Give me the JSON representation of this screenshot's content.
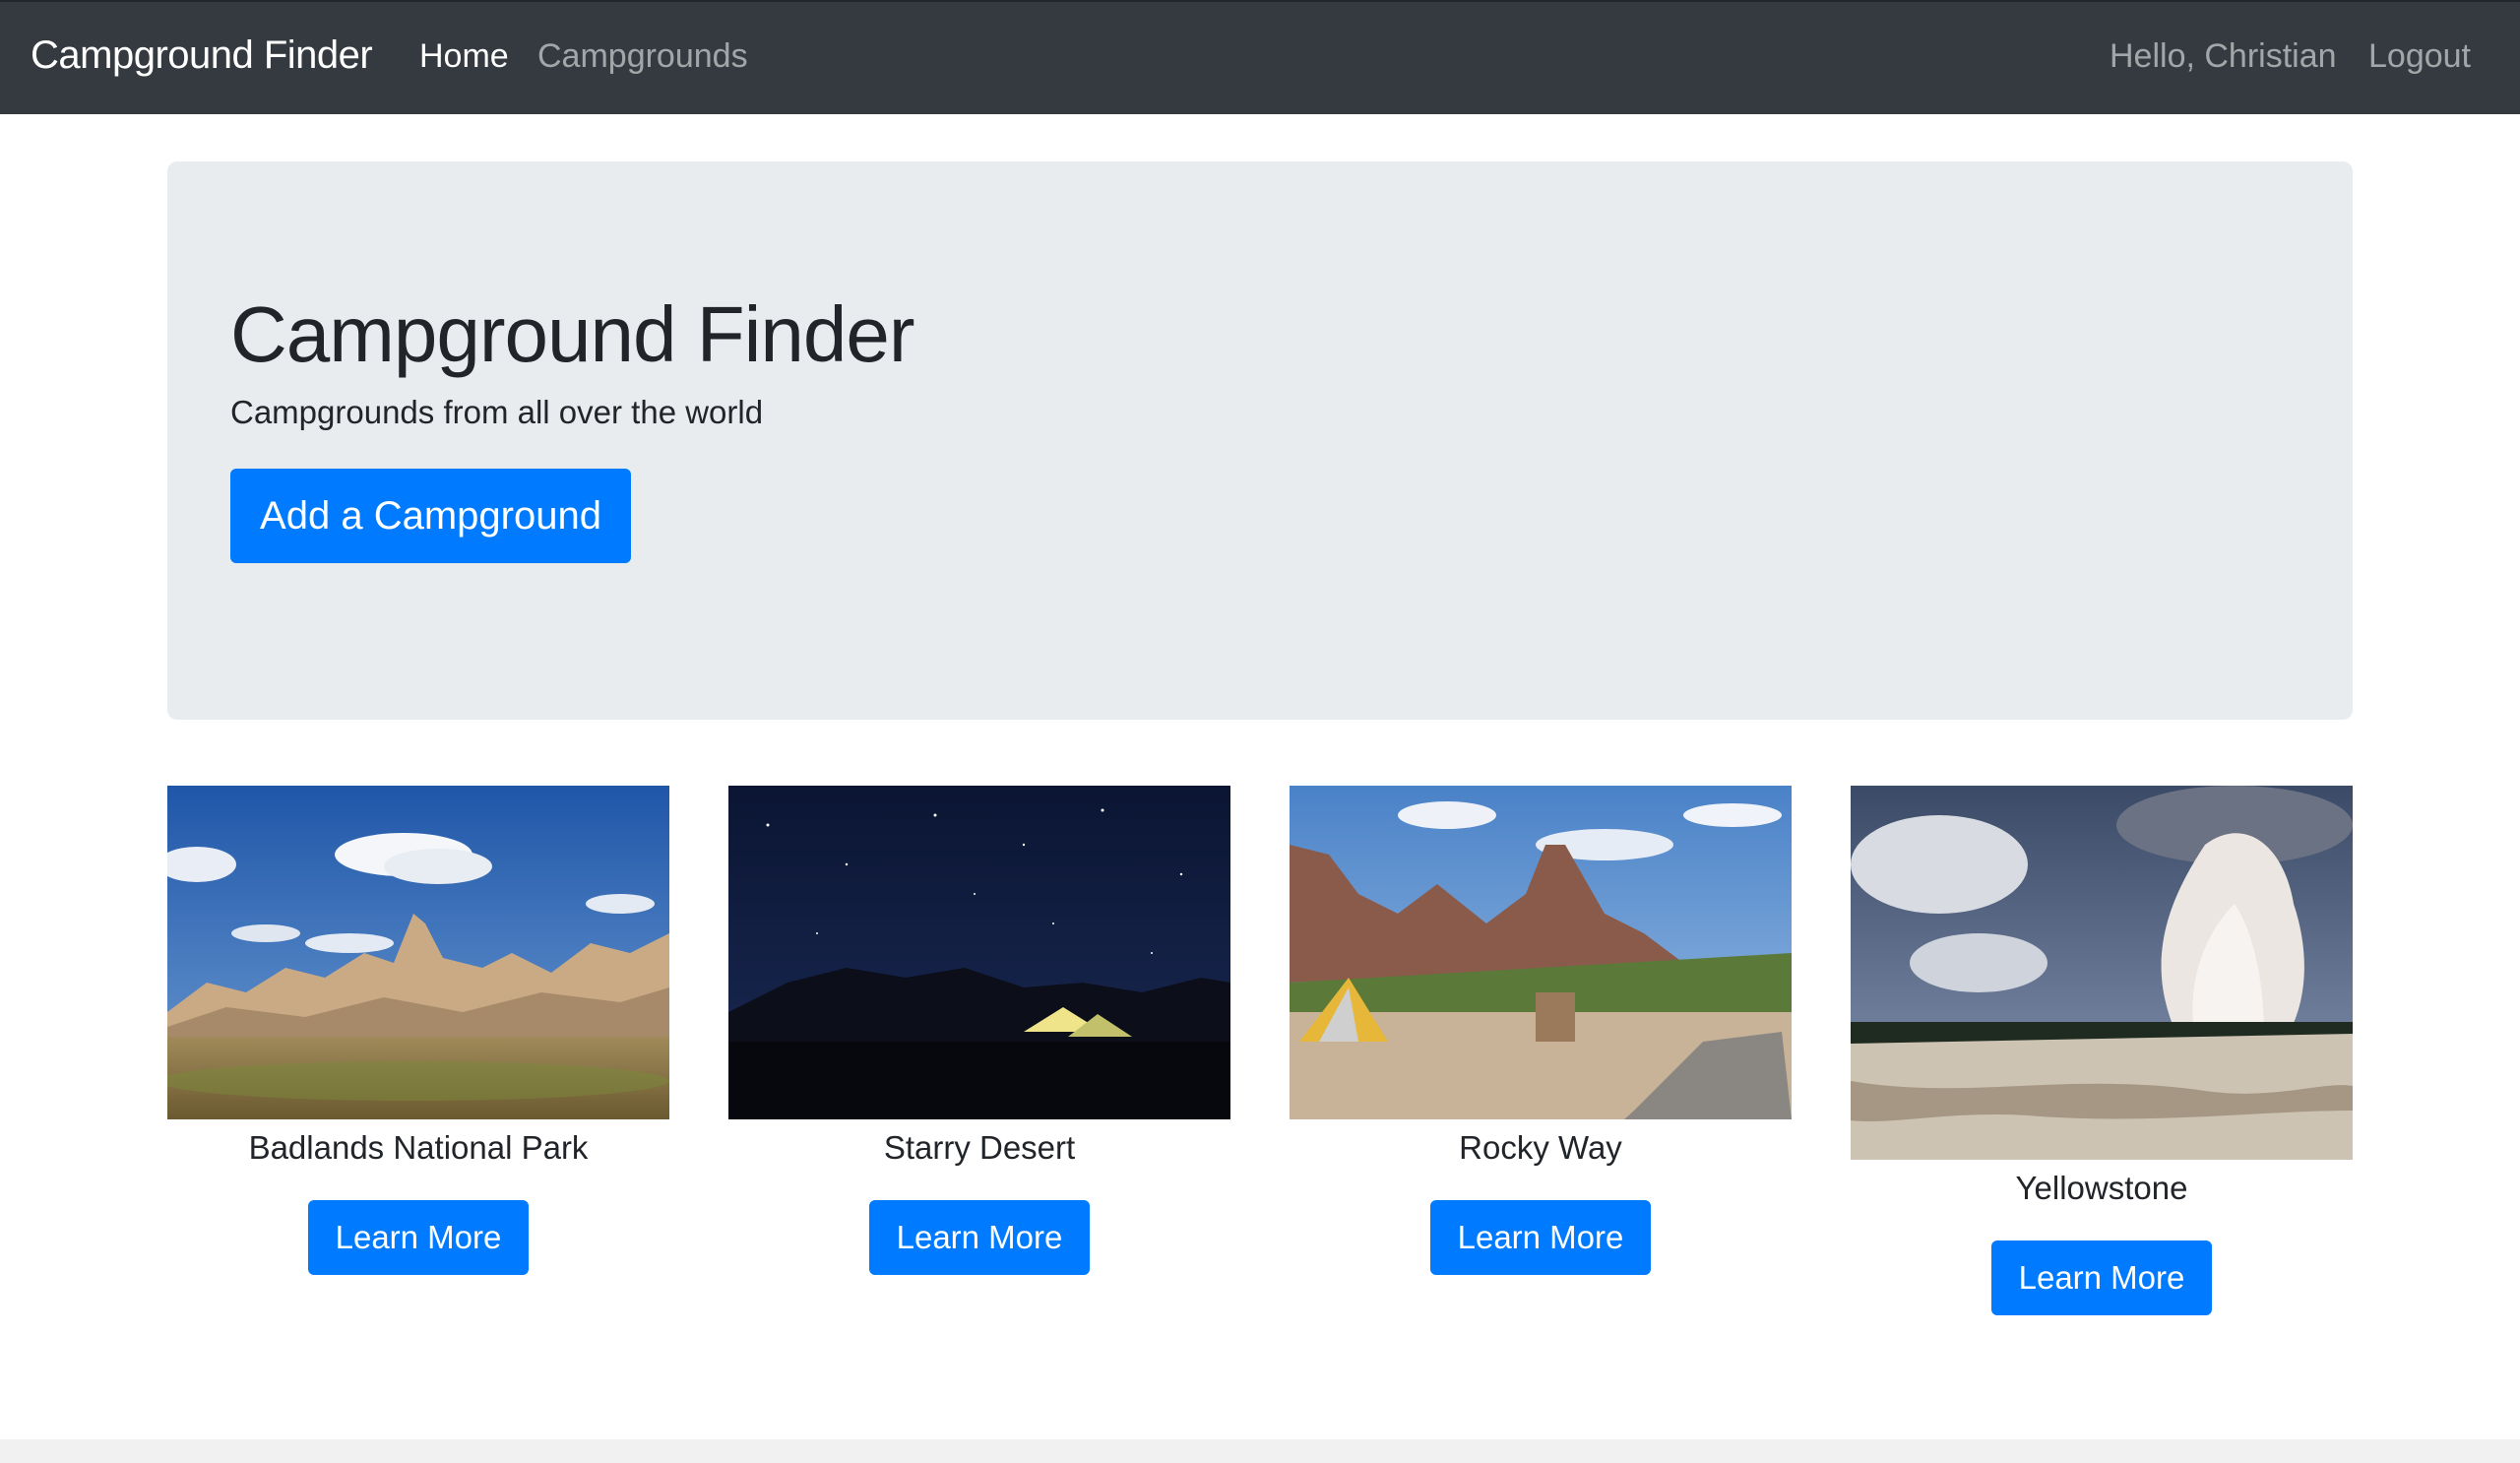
{
  "navbar": {
    "brand": "Campground Finder",
    "links": [
      "Home",
      "Campgrounds"
    ],
    "user_greeting": "Hello, Christian",
    "logout": "Logout"
  },
  "jumbotron": {
    "title": "Campground Finder",
    "lead": "Campgrounds from all over the world",
    "add_button": "Add a Campground"
  },
  "campgrounds": [
    {
      "name": "Badlands National Park",
      "button": "Learn More",
      "image": "badlands-landscape-image"
    },
    {
      "name": "Starry Desert",
      "button": "Learn More",
      "image": "night-tent-image"
    },
    {
      "name": "Rocky Way",
      "button": "Learn More",
      "image": "rocky-canyon-tent-image"
    },
    {
      "name": "Yellowstone",
      "button": "Learn More",
      "image": "geyser-image"
    }
  ],
  "colors": {
    "navbar_bg": "#343a40",
    "jumbotron_bg": "#e9ecef",
    "primary": "#007bff"
  }
}
